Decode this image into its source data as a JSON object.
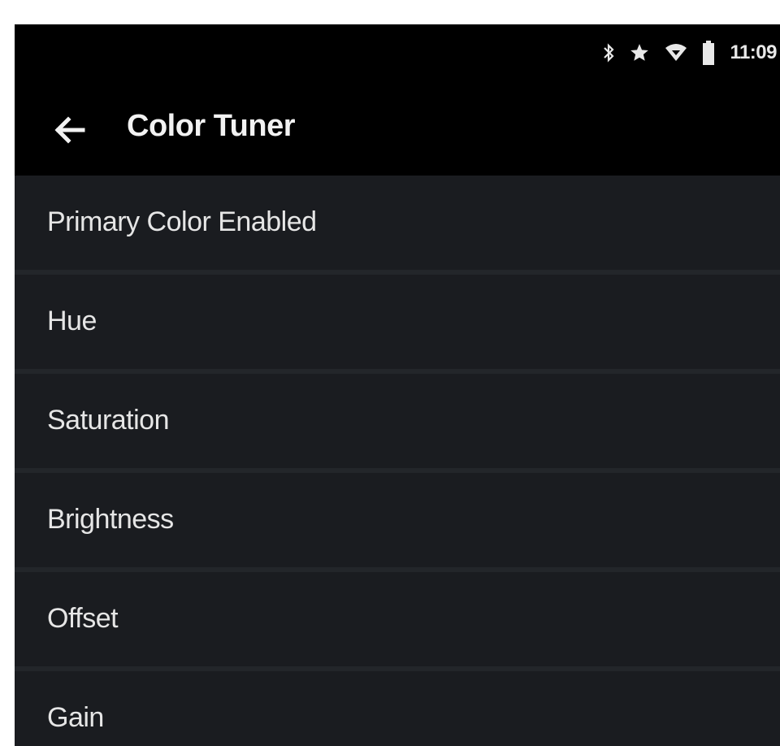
{
  "status_bar": {
    "icons": [
      "bluetooth-icon",
      "star-icon",
      "wifi-icon",
      "battery-icon"
    ],
    "time": "11:09"
  },
  "app_bar": {
    "back_icon": "arrow-left-icon",
    "title": "Color Tuner"
  },
  "settings": {
    "items": [
      {
        "label": "Primary Color Enabled"
      },
      {
        "label": "Hue"
      },
      {
        "label": "Saturation"
      },
      {
        "label": "Brightness"
      },
      {
        "label": "Offset"
      },
      {
        "label": "Gain"
      }
    ]
  },
  "colors": {
    "background": "#000000",
    "list_background": "#1a1c20",
    "divider": "#23262a",
    "text": "#e6e6e6"
  }
}
